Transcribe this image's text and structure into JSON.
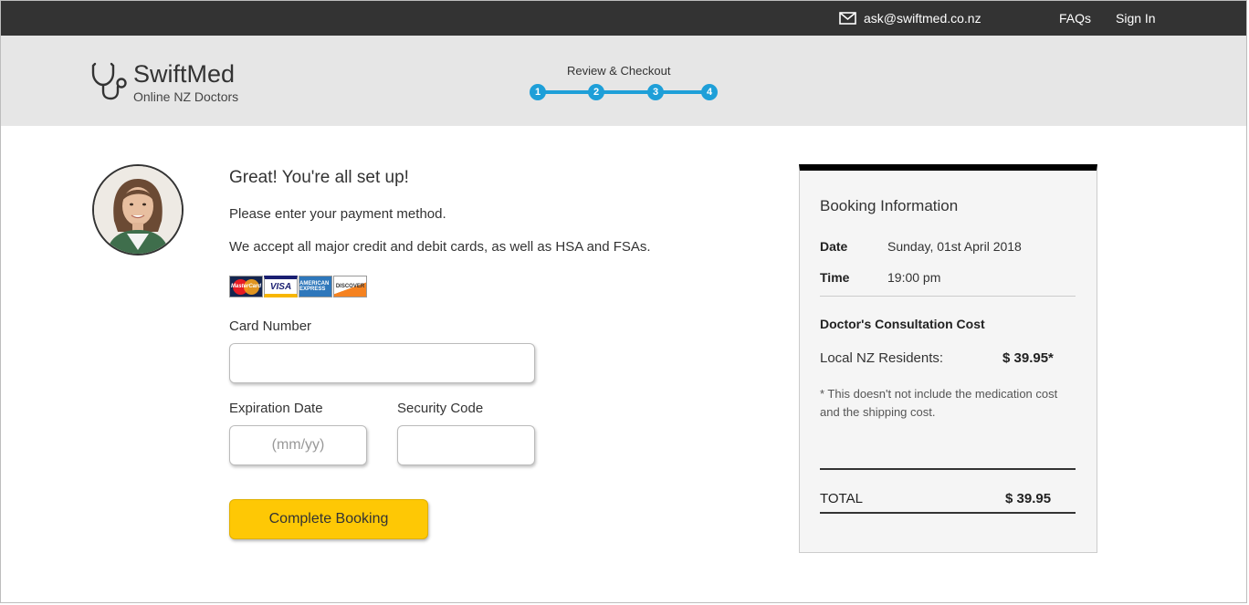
{
  "topbar": {
    "email": "ask@swiftmed.co.nz",
    "faqs": "FAQs",
    "signin": "Sign In"
  },
  "brand": {
    "name": "SwiftMed",
    "tagline": "Online NZ Doctors"
  },
  "progress": {
    "label": "Review & Checkout",
    "steps": [
      "1",
      "2",
      "3",
      "4"
    ],
    "color": "#1e9fd8"
  },
  "main": {
    "heading": "Great! You're all set up!",
    "line1": "Please enter your payment method.",
    "line2": "We accept all major credit and debit cards, as well as HSA and FSAs.",
    "cards": {
      "mastercard": "MasterCard",
      "visa": "VISA",
      "amex": "AMERICAN EXPRESS",
      "discover": "DISCOVER"
    },
    "card_number_label": "Card Number",
    "card_number_value": "",
    "expiration_label": "Expiration Date",
    "expiration_placeholder": "(mm/yy)",
    "security_label": "Security Code",
    "security_value": "",
    "submit": "Complete Booking",
    "submit_color": "#fec805"
  },
  "booking": {
    "title": "Booking Information",
    "date_label": "Date",
    "date_value": "Sunday, 01st April 2018",
    "time_label": "Time",
    "time_value": "19:00 pm",
    "cost_heading": "Doctor's Consultation Cost",
    "resident_label": "Local NZ Residents:",
    "resident_price": "$ 39.95*",
    "note": "* This doesn't not include the medication cost and the shipping cost.",
    "total_label": "TOTAL",
    "total_value": "$ 39.95"
  }
}
